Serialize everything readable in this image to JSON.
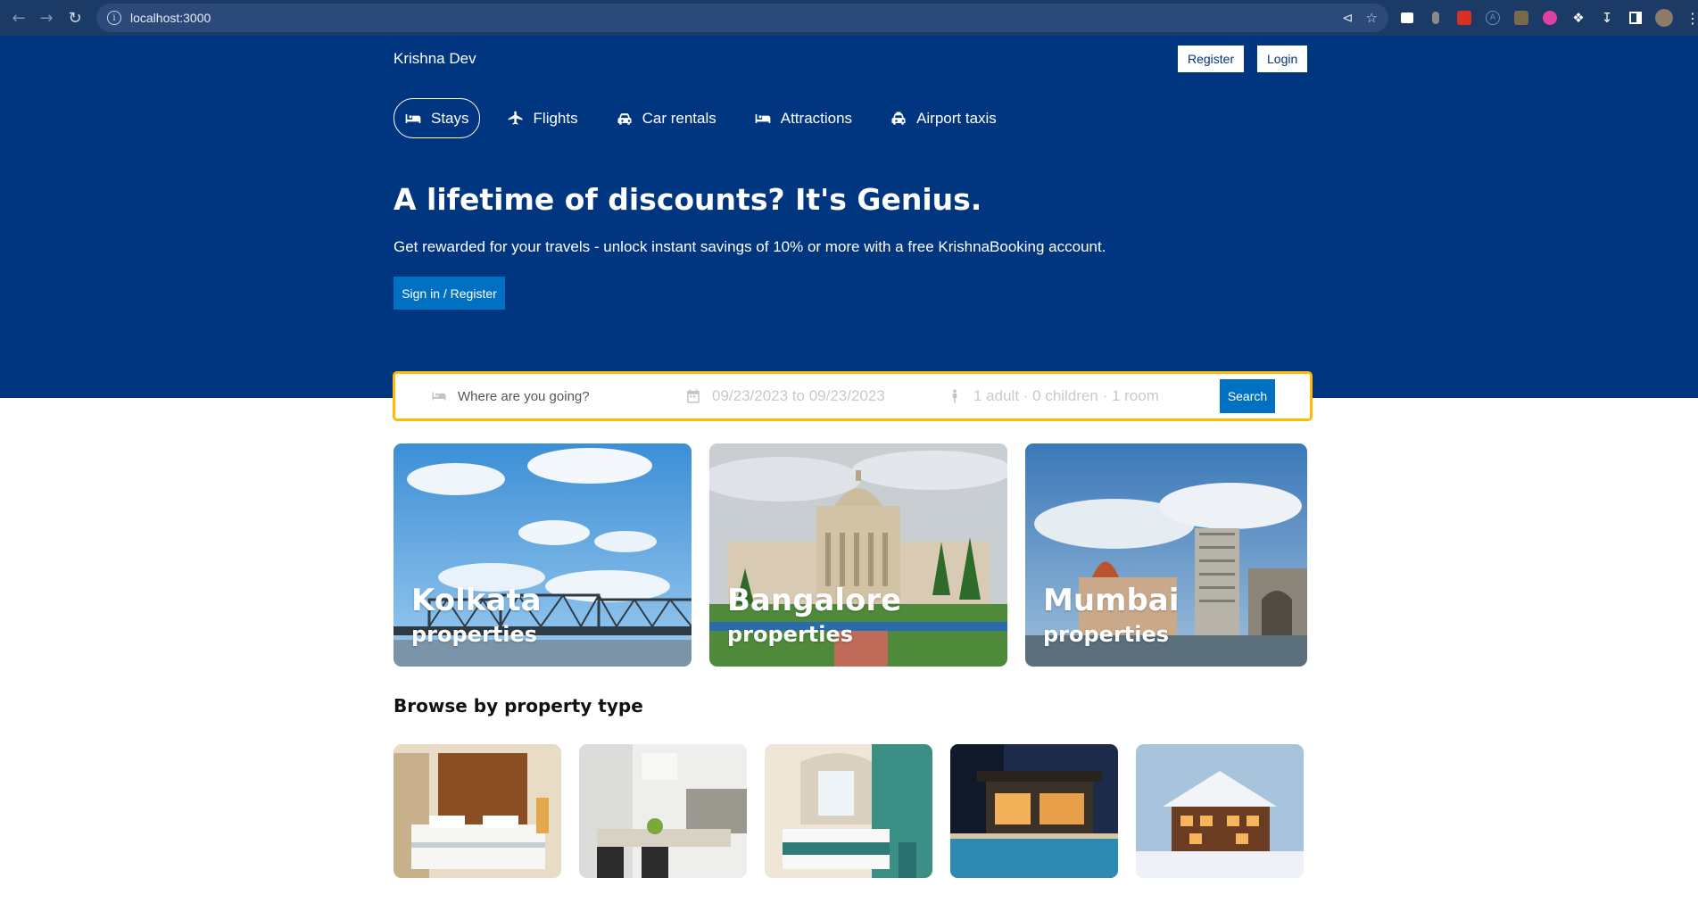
{
  "browser": {
    "url": "localhost:3000"
  },
  "header": {
    "brand": "Krishna Dev",
    "register_label": "Register",
    "login_label": "Login",
    "tabs": [
      {
        "label": "Stays",
        "icon": "bed-icon",
        "active": true
      },
      {
        "label": "Flights",
        "icon": "plane-icon",
        "active": false
      },
      {
        "label": "Car rentals",
        "icon": "car-icon",
        "active": false
      },
      {
        "label": "Attractions",
        "icon": "bed-icon",
        "active": false
      },
      {
        "label": "Airport taxis",
        "icon": "taxi-icon",
        "active": false
      }
    ],
    "hero_title": "A lifetime of discounts? It's Genius.",
    "hero_desc": "Get rewarded for your travels - unlock instant savings of 10% or more with a free KrishnaBooking account.",
    "hero_button": "Sign in / Register"
  },
  "search": {
    "destination_placeholder": "Where are you going?",
    "dates": "09/23/2023 to 09/23/2023",
    "guests": "1 adult · 0 children · 1 room",
    "button": "Search"
  },
  "featured": [
    {
      "city": "Kolkata",
      "sub": "properties"
    },
    {
      "city": "Bangalore",
      "sub": "properties"
    },
    {
      "city": "Mumbai",
      "sub": "properties"
    }
  ],
  "browse": {
    "title": "Browse by property type"
  },
  "colors": {
    "brand_blue": "#003580",
    "accent_blue": "#0071c2",
    "search_border": "#febb02"
  }
}
